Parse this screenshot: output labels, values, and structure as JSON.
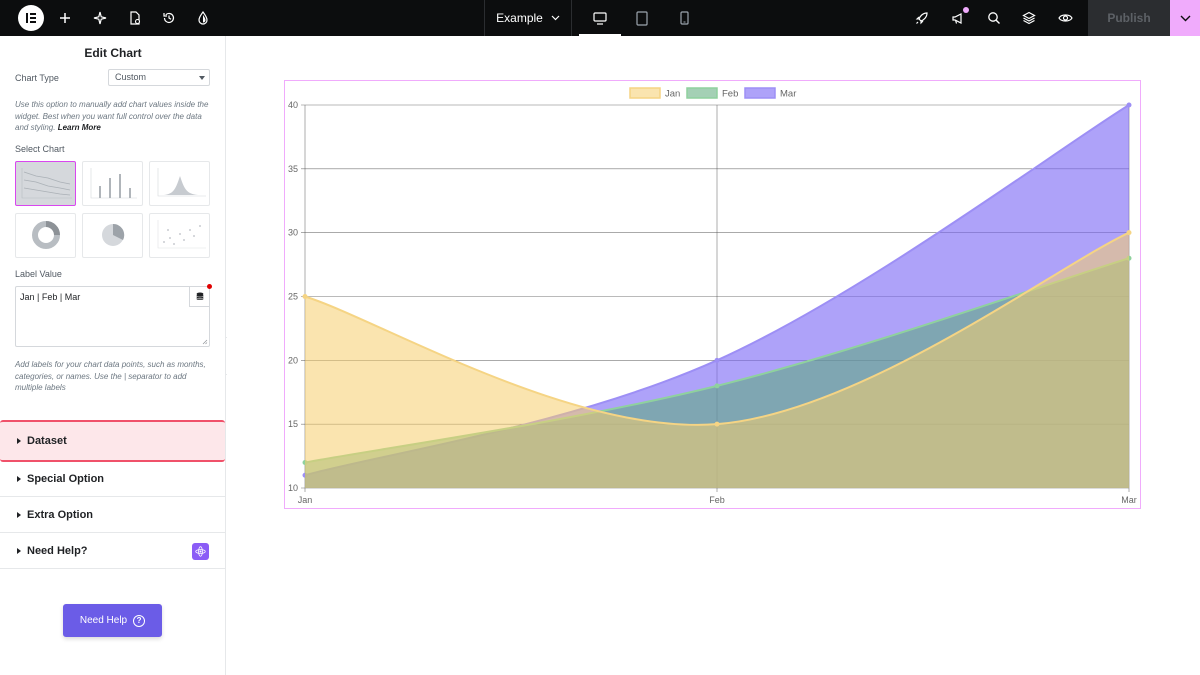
{
  "topbar": {
    "logo": "elementor-logo",
    "icons": [
      "plus-icon",
      "ai-sparkle-icon",
      "page-settings-icon",
      "history-icon",
      "theme-style-icon"
    ],
    "site_name": "Example",
    "devices": [
      "desktop-icon",
      "tablet-icon",
      "mobile-icon"
    ],
    "active_device": "desktop",
    "right_icons": [
      "rocket-icon",
      "announcements-icon",
      "search-icon",
      "layers-icon",
      "preview-eye-icon"
    ],
    "publish_label": "Publish"
  },
  "panel": {
    "title": "Edit Chart",
    "chart_type_label": "Chart Type",
    "chart_type_value": "Custom",
    "chart_type_help": "Use this option to manually add chart values inside the widget. Best when you want full control over the data and styling.",
    "learn_more": "Learn More",
    "select_chart_label": "Select Chart",
    "chart_options": [
      "line-chart-icon",
      "bar-chart-icon",
      "area-chart-icon",
      "doughnut-chart-icon",
      "pie-chart-icon",
      "scatter-chart-icon"
    ],
    "selected_chart": "line-chart-icon",
    "label_value_label": "Label Value",
    "label_value": "Jan | Feb | Mar",
    "label_help": "Add labels for your chart data points, such as months, categories, or names. Use the | separator to add multiple labels",
    "sections": [
      {
        "label": "Dataset",
        "highlighted": true
      },
      {
        "label": "Special Option",
        "highlighted": false
      },
      {
        "label": "Extra Option",
        "highlighted": false
      },
      {
        "label": "Need Help?",
        "highlighted": false
      }
    ],
    "need_help_button": "Need Help",
    "collapse_icon": "chevron-left-icon"
  },
  "colors": {
    "accent": "#f0abfc",
    "highlight_border": "#f0516a",
    "need_help_bg": "#6b5ce7"
  },
  "chart_data": {
    "type": "area",
    "categories": [
      "Jan",
      "Feb",
      "Mar"
    ],
    "series": [
      {
        "name": "Jan",
        "values": [
          25,
          15,
          30
        ],
        "fill": "rgba(245,205,110,0.55)",
        "stroke": "#f5d484"
      },
      {
        "name": "Feb",
        "values": [
          12,
          18,
          28
        ],
        "fill": "rgba(90,170,120,0.55)",
        "stroke": "#8fd19e"
      },
      {
        "name": "Mar",
        "values": [
          11,
          20,
          40
        ],
        "fill": "rgba(120,100,245,0.60)",
        "stroke": "#9d8ff5"
      }
    ],
    "y_ticks": [
      10,
      15,
      20,
      25,
      30,
      35,
      40
    ],
    "ylim": [
      10,
      40
    ],
    "grid": true,
    "legend": "top-center",
    "curve": "smooth"
  }
}
